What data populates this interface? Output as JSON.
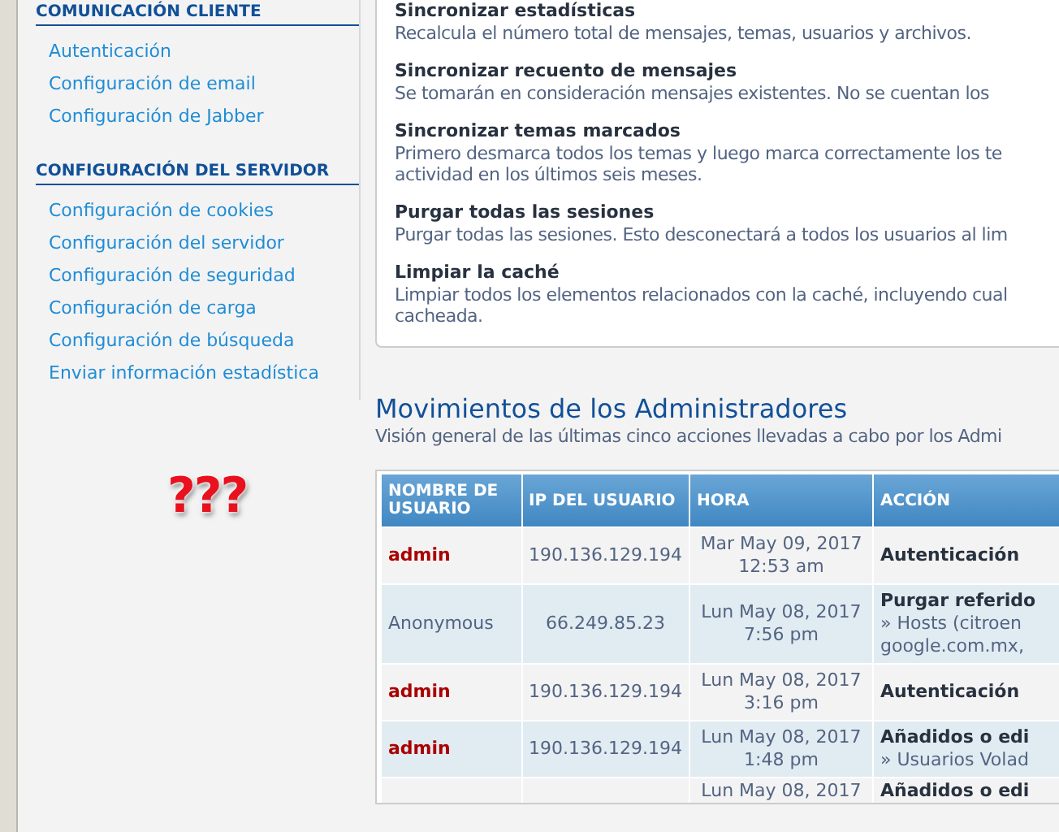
{
  "sidebar": {
    "sections": [
      {
        "title": "COMUNICACIÓN CLIENTE",
        "items": [
          "Autenticación",
          "Configuración de email",
          "Configuración de Jabber"
        ]
      },
      {
        "title": "CONFIGURACIÓN DEL SERVIDOR",
        "items": [
          "Configuración de cookies",
          "Configuración del servidor",
          "Configuración de seguridad",
          "Configuración de carga",
          "Configuración de búsqueda",
          "Enviar información estadística"
        ]
      }
    ],
    "annotation": "???"
  },
  "tools_panel": {
    "items": [
      {
        "title": "Sincronizar estadísticas",
        "description": "Recalcula el número total de mensajes, temas, usuarios y archivos."
      },
      {
        "title": "Sincronizar recuento de mensajes",
        "description": "Se tomarán en consideración mensajes existentes. No se cuentan los"
      },
      {
        "title": "Sincronizar temas marcados",
        "description": "Primero desmarca todos los temas y luego marca correctamente los te",
        "description_2": "actividad en los últimos seis meses."
      },
      {
        "title": "Purgar todas las sesiones",
        "description": "Purgar todas las sesiones. Esto desconectará a todos los usuarios al lim"
      },
      {
        "title": "Limpiar la caché",
        "description": "Limpiar todos los elementos relacionados con la caché, incluyendo cual",
        "description_2": "cacheada."
      }
    ]
  },
  "admin_log": {
    "title": "Movimientos de los Administradores",
    "description": "Visión general de las últimas cinco acciones llevadas a cabo por los Admi",
    "columns": [
      "NOMBRE DE USUARIO",
      "IP DEL USUARIO",
      "HORA",
      "ACCIÓN"
    ],
    "rows": [
      {
        "user": "admin",
        "kind": "admin",
        "ip": "190.136.129.194",
        "time": [
          "Mar May 09, 2017",
          "12:53 am"
        ],
        "action": "Autenticación",
        "details": []
      },
      {
        "user": "Anonymous",
        "kind": "guest",
        "ip": "66.249.85.23",
        "time": [
          "Lun May 08, 2017",
          "7:56 pm"
        ],
        "action": "Purgar referido",
        "details": [
          "» Hosts (citroen",
          "google.com.mx,"
        ]
      },
      {
        "user": "admin",
        "kind": "admin",
        "ip": "190.136.129.194",
        "time": [
          "Lun May 08, 2017",
          "3:16 pm"
        ],
        "action": "Autenticación",
        "details": []
      },
      {
        "user": "admin",
        "kind": "admin",
        "ip": "190.136.129.194",
        "time": [
          "Lun May 08, 2017",
          "1:48 pm"
        ],
        "action": "Añadidos o edi",
        "details": [
          "» Usuarios Volad"
        ]
      },
      {
        "kind": "partial",
        "time": [
          "Lun May 08, 2017"
        ],
        "action": "Añadidos o edi",
        "details": []
      }
    ]
  }
}
